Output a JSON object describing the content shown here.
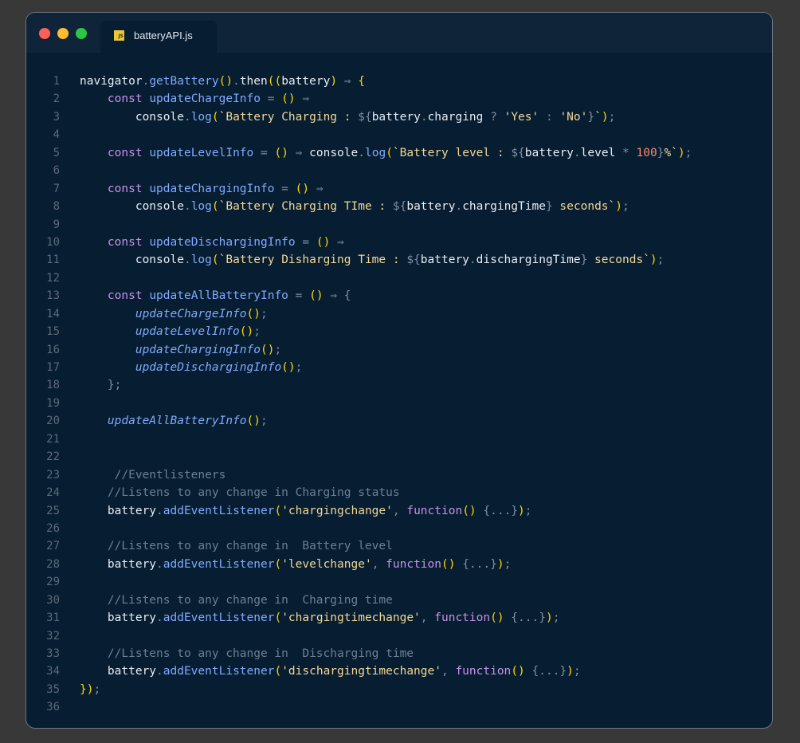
{
  "window": {
    "tab_label": "batteryAPI.js",
    "tab_icon": "js-file-icon",
    "colors": {
      "close": "#ff5f57",
      "minimize": "#febc2e",
      "maximize": "#28c840",
      "background": "#071d31"
    }
  },
  "code_lines": [
    {
      "n": "1",
      "tokens": [
        [
          "id",
          "navigator"
        ],
        [
          "op",
          "."
        ],
        [
          "fn",
          "getBattery"
        ],
        [
          "br",
          "()"
        ],
        [
          "op",
          "."
        ],
        [
          "id",
          "then"
        ],
        [
          "br",
          "(("
        ],
        [
          "id",
          "battery"
        ],
        [
          "br",
          ")"
        ],
        [
          "op",
          " ⇒ "
        ],
        [
          "br",
          "{"
        ]
      ]
    },
    {
      "n": "2",
      "tokens": [
        [
          "id",
          "    "
        ],
        [
          "kw",
          "const"
        ],
        [
          "id",
          " "
        ],
        [
          "fn",
          "updateChargeInfo"
        ],
        [
          "op",
          " = "
        ],
        [
          "br",
          "()"
        ],
        [
          "op",
          " ⇒"
        ]
      ]
    },
    {
      "n": "3",
      "tokens": [
        [
          "id",
          "        console"
        ],
        [
          "op",
          "."
        ],
        [
          "fn",
          "log"
        ],
        [
          "br",
          "("
        ],
        [
          "str",
          "`Battery Charging : "
        ],
        [
          "op",
          "${"
        ],
        [
          "id",
          "battery"
        ],
        [
          "op",
          "."
        ],
        [
          "id",
          "charging"
        ],
        [
          "op",
          " ? "
        ],
        [
          "str",
          "'Yes'"
        ],
        [
          "op",
          " : "
        ],
        [
          "str",
          "'No'"
        ],
        [
          "op",
          "}"
        ],
        [
          "str",
          "`"
        ],
        [
          "br",
          ")"
        ],
        [
          "op",
          ";"
        ]
      ]
    },
    {
      "n": "4",
      "tokens": []
    },
    {
      "n": "5",
      "tokens": [
        [
          "id",
          "    "
        ],
        [
          "kw",
          "const"
        ],
        [
          "id",
          " "
        ],
        [
          "fn",
          "updateLevelInfo"
        ],
        [
          "op",
          " = "
        ],
        [
          "br",
          "()"
        ],
        [
          "op",
          " ⇒ "
        ],
        [
          "id",
          "console"
        ],
        [
          "op",
          "."
        ],
        [
          "fn",
          "log"
        ],
        [
          "br",
          "("
        ],
        [
          "str",
          "`Battery level : "
        ],
        [
          "op",
          "${"
        ],
        [
          "id",
          "battery"
        ],
        [
          "op",
          "."
        ],
        [
          "id",
          "level"
        ],
        [
          "op",
          " * "
        ],
        [
          "num",
          "100"
        ],
        [
          "op",
          "}"
        ],
        [
          "str",
          "%`"
        ],
        [
          "br",
          ")"
        ],
        [
          "op",
          ";"
        ]
      ]
    },
    {
      "n": "6",
      "tokens": []
    },
    {
      "n": "7",
      "tokens": [
        [
          "id",
          "    "
        ],
        [
          "kw",
          "const"
        ],
        [
          "id",
          " "
        ],
        [
          "fn",
          "updateChargingInfo"
        ],
        [
          "op",
          " = "
        ],
        [
          "br",
          "()"
        ],
        [
          "op",
          " ⇒"
        ]
      ]
    },
    {
      "n": "8",
      "tokens": [
        [
          "id",
          "        console"
        ],
        [
          "op",
          "."
        ],
        [
          "fn",
          "log"
        ],
        [
          "br",
          "("
        ],
        [
          "str",
          "`Battery Charging TIme : "
        ],
        [
          "op",
          "${"
        ],
        [
          "id",
          "battery"
        ],
        [
          "op",
          "."
        ],
        [
          "id",
          "chargingTime"
        ],
        [
          "op",
          "}"
        ],
        [
          "str",
          " seconds`"
        ],
        [
          "br",
          ")"
        ],
        [
          "op",
          ";"
        ]
      ]
    },
    {
      "n": "9",
      "tokens": []
    },
    {
      "n": "10",
      "tokens": [
        [
          "id",
          "    "
        ],
        [
          "kw",
          "const"
        ],
        [
          "id",
          " "
        ],
        [
          "fn",
          "updateDischargingInfo"
        ],
        [
          "op",
          " = "
        ],
        [
          "br",
          "()"
        ],
        [
          "op",
          " ⇒"
        ]
      ]
    },
    {
      "n": "11",
      "tokens": [
        [
          "id",
          "        console"
        ],
        [
          "op",
          "."
        ],
        [
          "fn",
          "log"
        ],
        [
          "br",
          "("
        ],
        [
          "str",
          "`Battery Disharging Time : "
        ],
        [
          "op",
          "${"
        ],
        [
          "id",
          "battery"
        ],
        [
          "op",
          "."
        ],
        [
          "id",
          "dischargingTime"
        ],
        [
          "op",
          "}"
        ],
        [
          "str",
          " seconds`"
        ],
        [
          "br",
          ")"
        ],
        [
          "op",
          ";"
        ]
      ]
    },
    {
      "n": "12",
      "tokens": []
    },
    {
      "n": "13",
      "tokens": [
        [
          "id",
          "    "
        ],
        [
          "kw",
          "const"
        ],
        [
          "id",
          " "
        ],
        [
          "fn",
          "updateAllBatteryInfo"
        ],
        [
          "op",
          " = "
        ],
        [
          "br",
          "()"
        ],
        [
          "op",
          " ⇒ {"
        ]
      ]
    },
    {
      "n": "14",
      "tokens": [
        [
          "id",
          "        "
        ],
        [
          "fi",
          "updateChargeInfo"
        ],
        [
          "br",
          "()"
        ],
        [
          "op",
          ";"
        ]
      ]
    },
    {
      "n": "15",
      "tokens": [
        [
          "id",
          "        "
        ],
        [
          "fi",
          "updateLevelInfo"
        ],
        [
          "br",
          "()"
        ],
        [
          "op",
          ";"
        ]
      ]
    },
    {
      "n": "16",
      "tokens": [
        [
          "id",
          "        "
        ],
        [
          "fi",
          "updateChargingInfo"
        ],
        [
          "br",
          "()"
        ],
        [
          "op",
          ";"
        ]
      ]
    },
    {
      "n": "17",
      "tokens": [
        [
          "id",
          "        "
        ],
        [
          "fi",
          "updateDischargingInfo"
        ],
        [
          "br",
          "()"
        ],
        [
          "op",
          ";"
        ]
      ]
    },
    {
      "n": "18",
      "tokens": [
        [
          "op",
          "    };"
        ]
      ]
    },
    {
      "n": "19",
      "tokens": []
    },
    {
      "n": "20",
      "tokens": [
        [
          "id",
          "    "
        ],
        [
          "fi",
          "updateAllBatteryInfo"
        ],
        [
          "br",
          "()"
        ],
        [
          "op",
          ";"
        ]
      ]
    },
    {
      "n": "21",
      "tokens": []
    },
    {
      "n": "22",
      "tokens": []
    },
    {
      "n": "23",
      "tokens": [
        [
          "cm",
          "     //Eventlisteners"
        ]
      ]
    },
    {
      "n": "24",
      "tokens": [
        [
          "cm",
          "    //Listens to any change in Charging status"
        ]
      ]
    },
    {
      "n": "25",
      "tokens": [
        [
          "id",
          "    battery"
        ],
        [
          "op",
          "."
        ],
        [
          "fn",
          "addEventListener"
        ],
        [
          "br",
          "("
        ],
        [
          "str",
          "'chargingchange'"
        ],
        [
          "op",
          ", "
        ],
        [
          "kw",
          "function"
        ],
        [
          "br",
          "()"
        ],
        [
          "op",
          " {...}"
        ],
        [
          "br",
          ")"
        ],
        [
          "op",
          ";"
        ]
      ]
    },
    {
      "n": "26",
      "tokens": []
    },
    {
      "n": "27",
      "tokens": [
        [
          "cm",
          "    //Listens to any change in  Battery level"
        ]
      ]
    },
    {
      "n": "28",
      "tokens": [
        [
          "id",
          "    battery"
        ],
        [
          "op",
          "."
        ],
        [
          "fn",
          "addEventListener"
        ],
        [
          "br",
          "("
        ],
        [
          "str",
          "'levelchange'"
        ],
        [
          "op",
          ", "
        ],
        [
          "kw",
          "function"
        ],
        [
          "br",
          "()"
        ],
        [
          "op",
          " {...}"
        ],
        [
          "br",
          ")"
        ],
        [
          "op",
          ";"
        ]
      ]
    },
    {
      "n": "29",
      "tokens": []
    },
    {
      "n": "30",
      "tokens": [
        [
          "cm",
          "    //Listens to any change in  Charging time"
        ]
      ]
    },
    {
      "n": "31",
      "tokens": [
        [
          "id",
          "    battery"
        ],
        [
          "op",
          "."
        ],
        [
          "fn",
          "addEventListener"
        ],
        [
          "br",
          "("
        ],
        [
          "str",
          "'chargingtimechange'"
        ],
        [
          "op",
          ", "
        ],
        [
          "kw",
          "function"
        ],
        [
          "br",
          "()"
        ],
        [
          "op",
          " {...}"
        ],
        [
          "br",
          ")"
        ],
        [
          "op",
          ";"
        ]
      ]
    },
    {
      "n": "32",
      "tokens": []
    },
    {
      "n": "33",
      "tokens": [
        [
          "cm",
          "    //Listens to any change in  Discharging time"
        ]
      ]
    },
    {
      "n": "34",
      "tokens": [
        [
          "id",
          "    battery"
        ],
        [
          "op",
          "."
        ],
        [
          "fn",
          "addEventListener"
        ],
        [
          "br",
          "("
        ],
        [
          "str",
          "'dischargingtimechange'"
        ],
        [
          "op",
          ", "
        ],
        [
          "kw",
          "function"
        ],
        [
          "br",
          "()"
        ],
        [
          "op",
          " {...}"
        ],
        [
          "br",
          ")"
        ],
        [
          "op",
          ";"
        ]
      ]
    },
    {
      "n": "35",
      "tokens": [
        [
          "br",
          "})"
        ],
        [
          "op",
          ";"
        ]
      ]
    },
    {
      "n": "36",
      "tokens": []
    }
  ]
}
